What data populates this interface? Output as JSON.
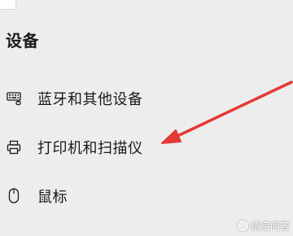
{
  "section": {
    "title": "设备"
  },
  "items": [
    {
      "id": "bluetooth",
      "label": "蓝牙和其他设备",
      "icon": "keyboard-icon"
    },
    {
      "id": "printers",
      "label": "打印机和扫描仪",
      "icon": "printer-icon"
    },
    {
      "id": "mouse",
      "label": "鼠标",
      "icon": "mouse-icon"
    }
  ],
  "annotation": {
    "arrow_color": "#e53935",
    "points_to": "printers"
  },
  "watermark": {
    "text": "悟空问答"
  },
  "colors": {
    "background": "#ededed",
    "text": "#1a1a1a",
    "arrow": "#e53935"
  }
}
